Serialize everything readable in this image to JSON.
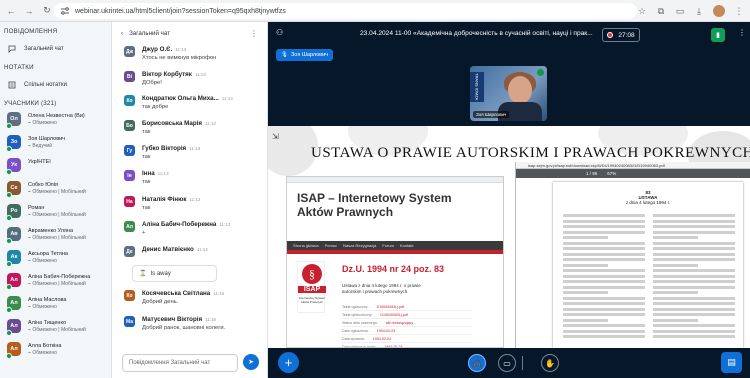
{
  "browser": {
    "url": "webinar.ukrintei.ua/html5client/join?sessionToken=q95qxh8tjnywtfzs"
  },
  "sidebar": {
    "messages_header": "ПОВІДОМЛЕННЯ",
    "public_chat": "Загальний чат",
    "notes_header": "НОТАТКИ",
    "shared_notes": "Спільні нотатки",
    "users_header": "УЧАСНИКИ (321)",
    "users": [
      {
        "initials": "Ол",
        "name": "Олена Незвестна (Ви)",
        "role": "Обмежено",
        "color": "#5c6f84"
      },
      {
        "initials": "Зо",
        "name": "Зоя Шарлович",
        "role": "Ведучий",
        "color": "#1f5fbf"
      },
      {
        "initials": "Ук",
        "name": "УкрІНТЕІ",
        "role": "",
        "color": "#7a4fc9"
      },
      {
        "initials": "Се",
        "name": "Собко Юлія",
        "role": "Обмежено | Мобільний",
        "color": "#8a5a2c"
      },
      {
        "initials": "Ро",
        "name": "Роман",
        "role": "Обмежено | Мобільний",
        "color": "#3f6d5e"
      },
      {
        "initials": "Ав",
        "name": "Авраменко Уляна",
        "role": "Обмежено | Мобільний",
        "color": "#546e7a"
      },
      {
        "initials": "Ак",
        "name": "Аксьора Тетяна",
        "role": "Обмежено",
        "color": "#1e88a8"
      },
      {
        "initials": "Ал",
        "name": "Аліна Бабич-Побережна",
        "role": "Обмежено | Мобільний",
        "color": "#c2185b"
      },
      {
        "initials": "Ал",
        "name": "Аліна Маслова",
        "role": "Обмежено",
        "color": "#3a8d4f"
      },
      {
        "initials": "Ал",
        "name": "Аліна Тищенко",
        "role": "Обмежено | Мобільний",
        "color": "#6a4c93"
      },
      {
        "initials": "Ал",
        "name": "Алла Боткіна",
        "role": "Обмежено",
        "color": "#b85c1e"
      }
    ]
  },
  "chat": {
    "title": "Загальний чат",
    "away_label": "Is away",
    "input_placeholder": "Повідомлення Загальний чат",
    "messages": [
      {
        "initials": "Дж",
        "name": "Джур О.Є.",
        "time": "11:13",
        "text": "Хтось не вимкнув мікрофон",
        "color": "#5c6f84"
      },
      {
        "initials": "Ві",
        "name": "Віктор Корбутяк",
        "time": "11:13",
        "text": "ДОбре!",
        "color": "#6a4c93"
      },
      {
        "initials": "Ко",
        "name": "Кондратюк Ольга Миха...",
        "time": "11:13",
        "text": "так добре",
        "color": "#1e88a8"
      },
      {
        "initials": "Бо",
        "name": "Борисовська Марія",
        "time": "11:13",
        "text": "так",
        "color": "#3f6d5e"
      },
      {
        "initials": "Гу",
        "name": "Губко Вікторія",
        "time": "11:13",
        "text": "так",
        "color": "#1f5fbf"
      },
      {
        "initials": "Ін",
        "name": "Інна",
        "time": "11:13",
        "text": "так",
        "color": "#7a4fc9"
      },
      {
        "initials": "На",
        "name": "Наталія Фінюк",
        "time": "11:13",
        "text": "так",
        "color": "#c2185b"
      },
      {
        "initials": "Ал",
        "name": "Аліна Бабич-Побережна",
        "time": "11:13",
        "text": "+",
        "color": "#3a8d4f"
      },
      {
        "initials": "Де",
        "name": "Денис Матвієнко",
        "time": "11:14",
        "text": "",
        "color": "#5c6f84"
      },
      {
        "initials": "Ко",
        "name": "Косячевська Світлана",
        "time": "11:16",
        "text": "Добрий день.",
        "color": "#b85c1e"
      },
      {
        "initials": "Ма",
        "name": "Матусевич Вікторія",
        "time": "11:16",
        "text": "Добрий ранок, шановні колеги.",
        "color": "#1f5fbf"
      }
    ]
  },
  "meeting": {
    "title": "23.04.2024 11-00 «Академічна доброчесність в сучасній освіті, науці і прак...",
    "recording_time": "27:08",
    "presenter": "Зоя Шарлович",
    "webcam_name": "Зоя Шарлович",
    "webcam_banner": "TRANS IOMZA"
  },
  "slide": {
    "title": "USTAWA O PRAWIE AUTORSKIM I PRAWACH POKREWNYCH",
    "isap_title": "ISAP – Internetowy System Aktów Prawnych",
    "isap_line1": "ISAP – Internetowy System",
    "isap_line2": "Aktów Prawnych",
    "isap_nav": [
      "Strona główna",
      "Pomoc",
      "Nasza Rezygnacja",
      "Forum",
      "Kontakt"
    ],
    "logo_symbol": "§",
    "logo_text": "ISAP",
    "logo_sub": "Internetowy System Aktów Prawnych",
    "dzu": "Dz.U. 1994 nr 24 poz. 83",
    "act_title": "Ustawa z dnia 4 lutego 1994 r. o prawie autorskim i prawach pokrewnych.",
    "meta_rows": [
      {
        "k": "Tekst ogłoszony:",
        "v": "D19940083Lj.pdf"
      },
      {
        "k": "Tekst ujednolicony:",
        "v": "D19940083Lj.pdf"
      },
      {
        "k": "Status aktu prawnego:",
        "v": "akt obowiązujący"
      },
      {
        "k": "Data ogłoszenia:",
        "v": "1994-02-23"
      },
      {
        "k": "Data wydania:",
        "v": "1994-02-04"
      },
      {
        "k": "Data wejścia w życie:",
        "v": "1994-05-24"
      }
    ],
    "pdf_url": "isap.sejm.gov.pl/isap.nsf/download.xsp/WDU19940240083/O/D19940083.pdf",
    "pdf_page": "1 / 95",
    "pdf_zoom": "67%",
    "doc_page_number": "83",
    "doc_heading": "USTAWA",
    "doc_date": "z dnia 4 lutego 1994 r."
  }
}
